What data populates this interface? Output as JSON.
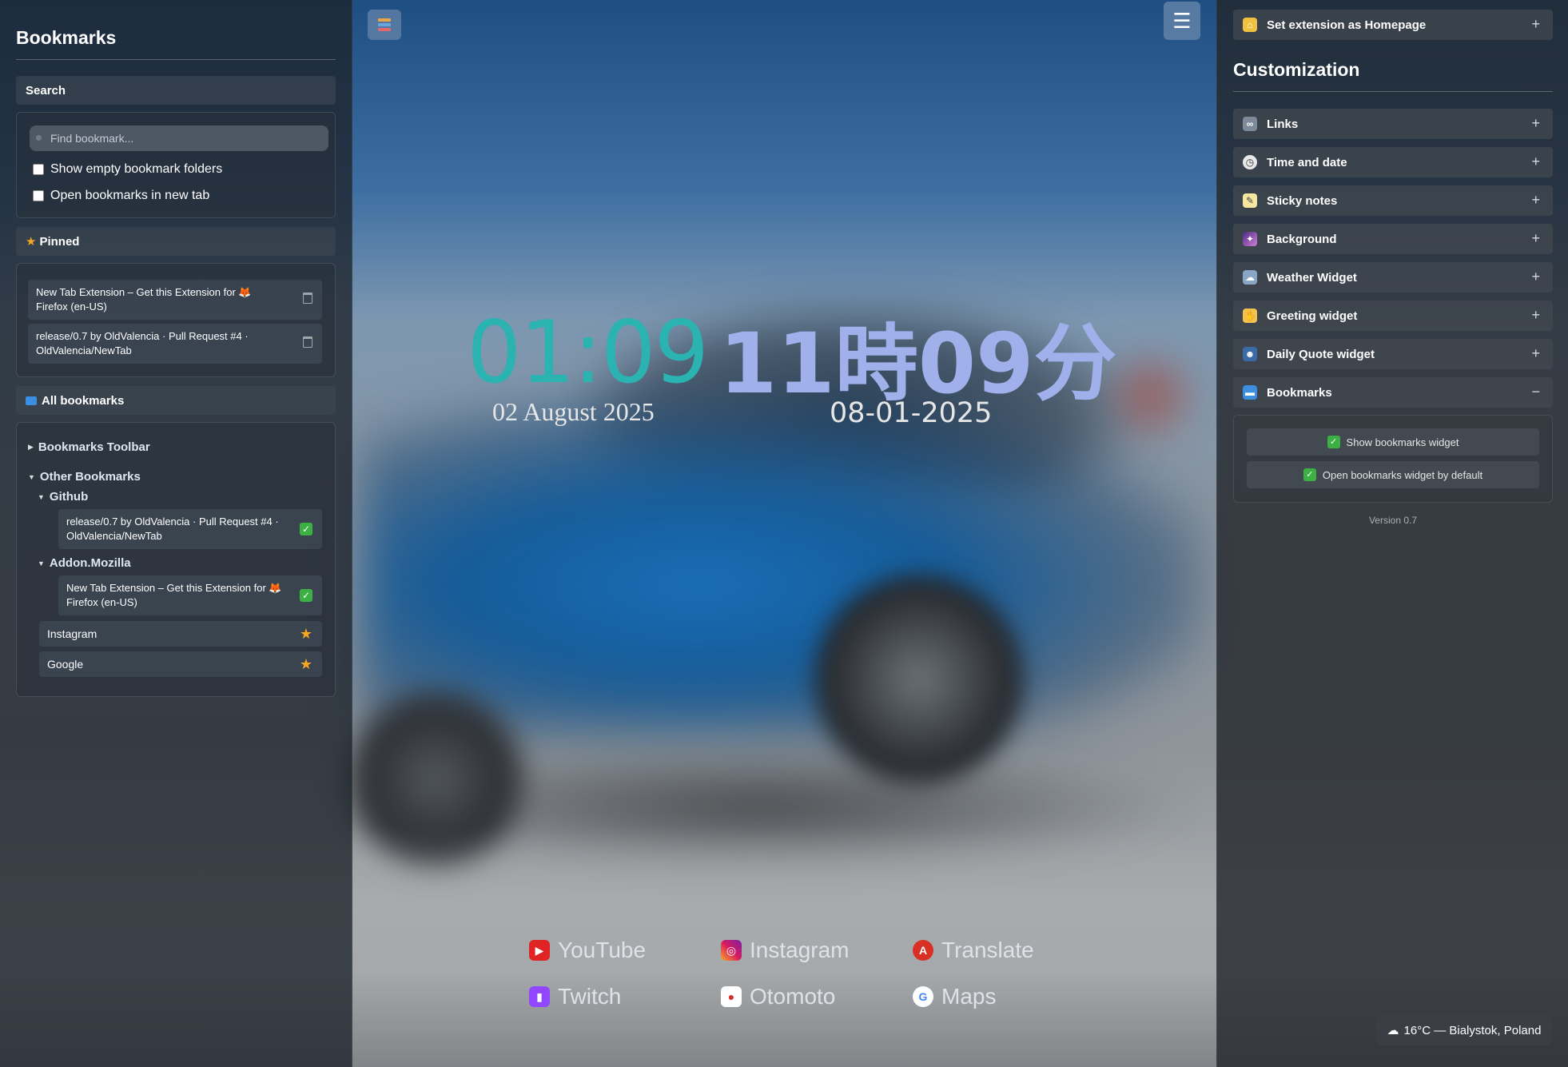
{
  "left": {
    "title": "Bookmarks",
    "search_header": "Search",
    "search_placeholder": "Find bookmark...",
    "show_empty_label": "Show empty bookmark folders",
    "open_new_tab_label": "Open bookmarks in new tab",
    "pinned_header": "Pinned",
    "pinned": [
      {
        "text": "New Tab Extension – Get this Extension for 🦊 Firefox (en-US)"
      },
      {
        "text": "release/0.7 by OldValencia · Pull Request #4 · OldValencia/NewTab"
      }
    ],
    "all_header": "All bookmarks",
    "toolbar_folder": "Bookmarks Toolbar",
    "other_folder": "Other Bookmarks",
    "github_folder": "Github",
    "github_item": "release/0.7 by OldValencia · Pull Request #4 · OldValencia/NewTab",
    "addon_folder": "Addon.Mozilla",
    "addon_item": "New Tab Extension – Get this Extension for 🦊 Firefox (en-US)",
    "instagram": "Instagram",
    "google": "Google"
  },
  "clock": {
    "time": "01:09",
    "date": "02 August 2025",
    "jp_time": "11時09分",
    "jp_date": "08-01-2025"
  },
  "links": [
    {
      "label": "YouTube",
      "icon": "youtube-icon",
      "color": "#e02424"
    },
    {
      "label": "Instagram",
      "icon": "instagram-icon",
      "color": "#c13584"
    },
    {
      "label": "Translate",
      "icon": "translate-icon",
      "color": "#d93025"
    },
    {
      "label": "Twitch",
      "icon": "twitch-icon",
      "color": "#9146ff"
    },
    {
      "label": "Otomoto",
      "icon": "otomoto-icon",
      "color": "#d32f2f"
    },
    {
      "label": "Maps",
      "icon": "google-icon",
      "color": "#4285f4"
    }
  ],
  "right": {
    "homepage": "Set extension as Homepage",
    "title": "Customization",
    "items": [
      {
        "label": "Links",
        "sign": "+"
      },
      {
        "label": "Time and date",
        "sign": "+"
      },
      {
        "label": "Sticky notes",
        "sign": "+"
      },
      {
        "label": "Background",
        "sign": "+"
      },
      {
        "label": "Weather Widget",
        "sign": "+"
      },
      {
        "label": "Greeting widget",
        "sign": "+"
      },
      {
        "label": "Daily Quote widget",
        "sign": "+"
      },
      {
        "label": "Bookmarks",
        "sign": "−"
      }
    ],
    "opt_show": "Show bookmarks widget",
    "opt_default": "Open bookmarks widget by default",
    "version": "Version 0.7"
  },
  "weather": "16°C — Bialystok, Poland"
}
